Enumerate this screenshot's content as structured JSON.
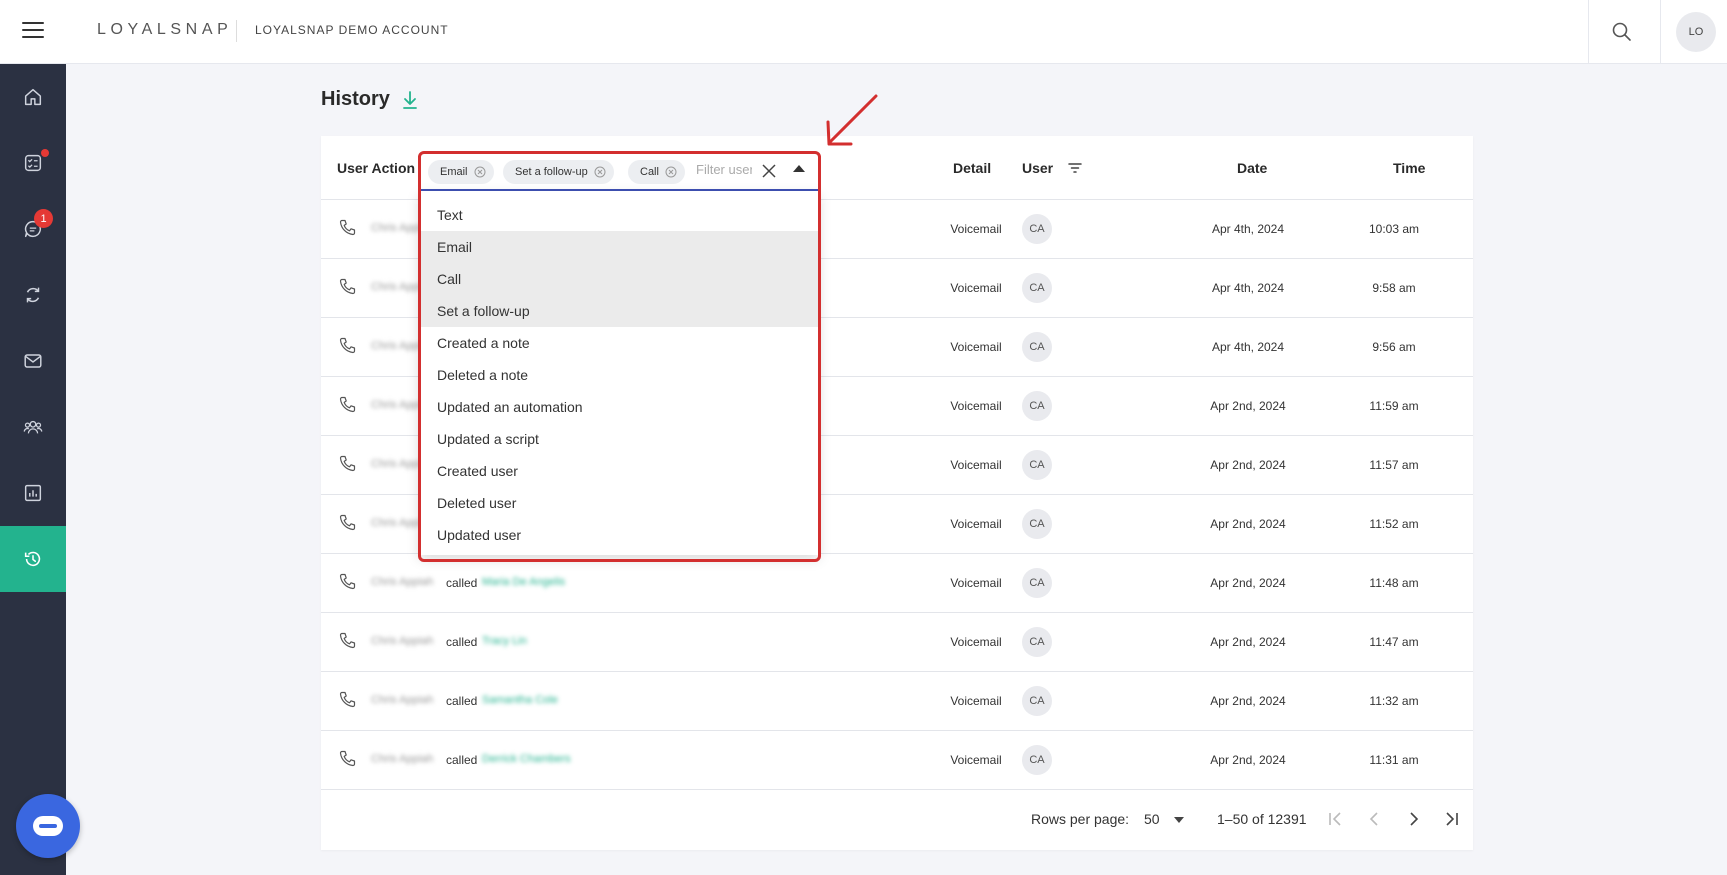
{
  "header": {
    "logo_text": "LOYALSNAP",
    "account_name": "LOYALSNAP DEMO ACCOUNT",
    "user_initials": "LO",
    "icons": [
      "hamburger-menu-icon",
      "search-icon"
    ]
  },
  "sidebar": {
    "items": [
      {
        "name": "home-icon",
        "active": false
      },
      {
        "name": "tasks-icon",
        "active": false,
        "has_dot": true
      },
      {
        "name": "messages-icon",
        "active": false,
        "badge": "1"
      },
      {
        "name": "sync-icon",
        "active": false
      },
      {
        "name": "mail-icon",
        "active": false
      },
      {
        "name": "people-icon",
        "active": false
      },
      {
        "name": "reports-icon",
        "active": false
      },
      {
        "name": "history-icon",
        "active": true
      }
    ],
    "colors": {
      "background": "#2b3142",
      "active": "#23b38e"
    }
  },
  "page": {
    "title": "History"
  },
  "table": {
    "columns": {
      "user_action": "User Action",
      "detail": "Detail",
      "user": "User",
      "date": "Date",
      "time": "Time"
    },
    "rows": [
      {
        "actor": "Chris Appiah",
        "verb": "",
        "target": "",
        "detail": "Voicemail",
        "user": "CA",
        "date": "Apr 4th, 2024",
        "time": "10:03 am"
      },
      {
        "actor": "Chris Appiah",
        "verb": "",
        "target": "",
        "detail": "Voicemail",
        "user": "CA",
        "date": "Apr 4th, 2024",
        "time": "9:58 am"
      },
      {
        "actor": "Chris Appiah",
        "verb": "",
        "target": "",
        "detail": "Voicemail",
        "user": "CA",
        "date": "Apr 4th, 2024",
        "time": "9:56 am"
      },
      {
        "actor": "Chris Appiah",
        "verb": "",
        "target": "",
        "detail": "Voicemail",
        "user": "CA",
        "date": "Apr 2nd, 2024",
        "time": "11:59 am"
      },
      {
        "actor": "Chris Appiah",
        "verb": "",
        "target": "",
        "detail": "Voicemail",
        "user": "CA",
        "date": "Apr 2nd, 2024",
        "time": "11:57 am"
      },
      {
        "actor": "Chris Appiah",
        "verb": "",
        "target": "",
        "detail": "Voicemail",
        "user": "CA",
        "date": "Apr 2nd, 2024",
        "time": "11:52 am"
      },
      {
        "actor": "Chris Appiah",
        "verb": "called",
        "target": "Maria De Angelis",
        "detail": "Voicemail",
        "user": "CA",
        "date": "Apr 2nd, 2024",
        "time": "11:48 am"
      },
      {
        "actor": "Chris Appiah",
        "verb": "called",
        "target": "Tracy Lin",
        "detail": "Voicemail",
        "user": "CA",
        "date": "Apr 2nd, 2024",
        "time": "11:47 am"
      },
      {
        "actor": "Chris Appiah",
        "verb": "called",
        "target": "Samantha Cole",
        "detail": "Voicemail",
        "user": "CA",
        "date": "Apr 2nd, 2024",
        "time": "11:32 am"
      },
      {
        "actor": "Chris Appiah",
        "verb": "called",
        "target": "Derrick Chambers",
        "detail": "Voicemail",
        "user": "CA",
        "date": "Apr 2nd, 2024",
        "time": "11:31 am"
      }
    ]
  },
  "filter": {
    "chips": [
      "Email",
      "Set a follow-up",
      "Call"
    ],
    "placeholder": "Filter user actions",
    "options": [
      {
        "label": "Text",
        "selected": false
      },
      {
        "label": "Email",
        "selected": true
      },
      {
        "label": "Call",
        "selected": true
      },
      {
        "label": "Set a follow-up",
        "selected": true
      },
      {
        "label": "Created a note",
        "selected": false
      },
      {
        "label": "Deleted a note",
        "selected": false
      },
      {
        "label": "Updated an automation",
        "selected": false
      },
      {
        "label": "Updated a script",
        "selected": false
      },
      {
        "label": "Created user",
        "selected": false
      },
      {
        "label": "Deleted user",
        "selected": false
      },
      {
        "label": "Updated user",
        "selected": false
      }
    ]
  },
  "pagination": {
    "rows_per_page_label": "Rows per page:",
    "rows_per_page": "50",
    "range": "1–50 of 12391"
  },
  "colors": {
    "accent": "#23b38e",
    "highlight_outline": "#d32f2f",
    "focus_underline": "#3f51b5",
    "chat_button": "#3a67e0"
  }
}
